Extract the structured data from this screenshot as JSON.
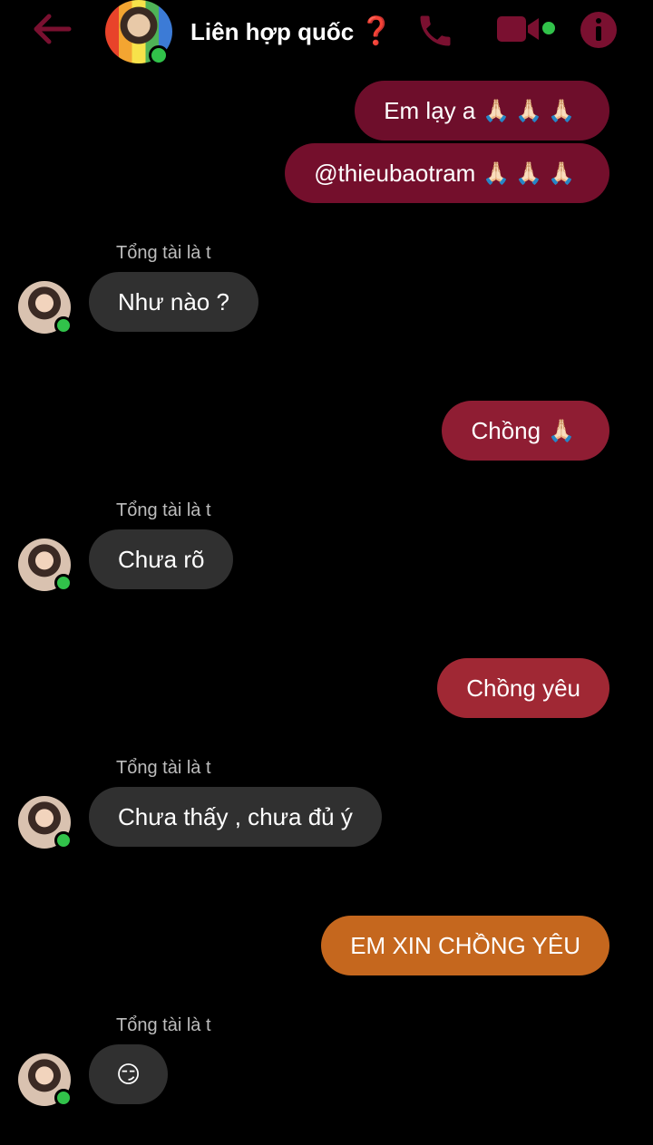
{
  "header": {
    "title": "Liên hợp quốc",
    "title_emoji": "❓",
    "accent": "#7a1030"
  },
  "messages": [
    {
      "direction": "out",
      "text": "Em lạy a",
      "emoji": "🙏🏻🙏🏻🙏🏻",
      "color": "#6e0e2b"
    },
    {
      "direction": "out",
      "text": "@thieubaotram",
      "emoji": "🙏🏻🙏🏻🙏🏻",
      "color": "#740f2c"
    },
    {
      "direction": "in",
      "sender": "Tổng tài là t",
      "text": "Như nào ?"
    },
    {
      "direction": "out",
      "text": "Chồng",
      "emoji": "🙏🏻",
      "color": "#8f1d33"
    },
    {
      "direction": "in",
      "sender": "Tổng tài là t",
      "text": "Chưa rõ"
    },
    {
      "direction": "out",
      "text": "Chồng yêu",
      "emoji": "",
      "color": "#a02834"
    },
    {
      "direction": "in",
      "sender": "Tổng tài là t",
      "text": "Chưa thấy , chưa đủ ý"
    },
    {
      "direction": "out",
      "text": "EM XIN CHỒNG YÊU",
      "emoji": "",
      "color": "#c5671e"
    },
    {
      "direction": "in",
      "sender": "Tổng tài là t",
      "text": "😏"
    }
  ]
}
